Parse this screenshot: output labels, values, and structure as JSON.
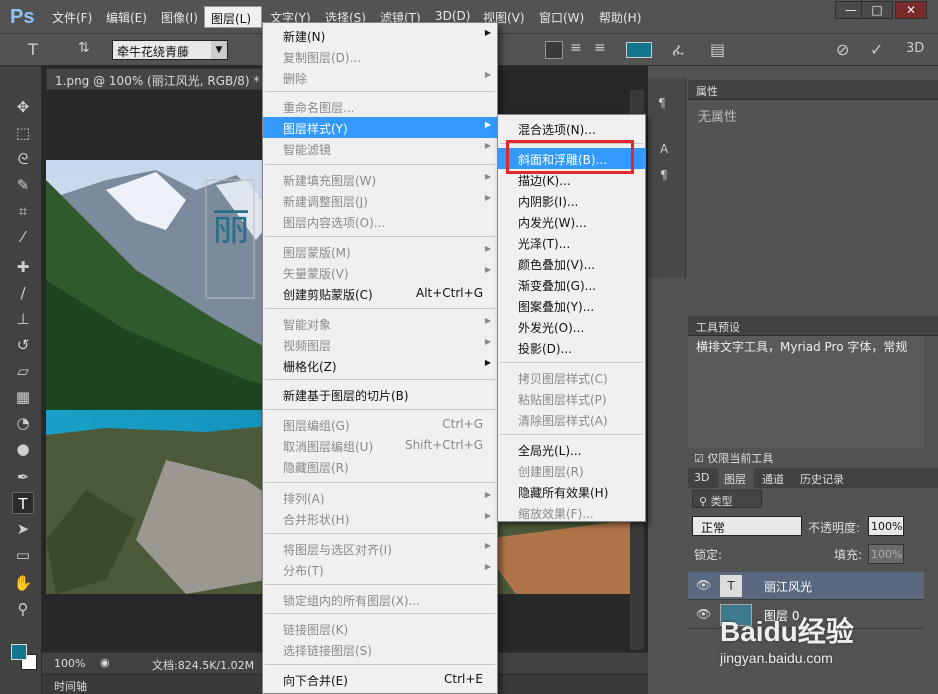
{
  "app": {
    "logo": "Ps"
  },
  "menubar": [
    "文件(F)",
    "编辑(E)",
    "图像(I)",
    "图层(L)",
    "文字(Y)",
    "选择(S)",
    "滤镜(T)",
    "3D(D)",
    "视图(V)",
    "窗口(W)",
    "帮助(H)"
  ],
  "window_controls": [
    "—",
    "□",
    "✕"
  ],
  "options": {
    "font_family": "牵牛花绕青藤",
    "t_label": "T"
  },
  "document": {
    "tab": "1.png @ 100% (丽江风光, RGB/8) *",
    "close": "×",
    "zoom": "100%",
    "doc_size": "文档:824.5K/1.02M",
    "timeline": "时间轴"
  },
  "layer_menu": [
    {
      "label": "新建(N)",
      "arrow": true
    },
    {
      "label": "复制图层(D)...",
      "disabled": true
    },
    {
      "label": "删除",
      "arrow": true,
      "disabled": true
    },
    {
      "label": "重命名图层...",
      "disabled": true
    },
    {
      "label": "图层样式(Y)",
      "arrow": true,
      "highlight": true
    },
    {
      "label": "智能滤镜",
      "arrow": true,
      "disabled": true
    },
    {
      "label": "新建填充图层(W)",
      "arrow": true,
      "disabled": true
    },
    {
      "label": "新建调整图层(J)",
      "arrow": true,
      "disabled": true
    },
    {
      "label": "图层内容选项(O)...",
      "disabled": true
    },
    {
      "label": "图层蒙版(M)",
      "arrow": true,
      "disabled": true
    },
    {
      "label": "矢量蒙版(V)",
      "arrow": true,
      "disabled": true
    },
    {
      "label": "创建剪贴蒙版(C)",
      "shortcut": "Alt+Ctrl+G"
    },
    {
      "label": "智能对象",
      "arrow": true,
      "disabled": true
    },
    {
      "label": "视频图层",
      "arrow": true,
      "disabled": true
    },
    {
      "label": "栅格化(Z)",
      "arrow": true
    },
    {
      "label": "新建基于图层的切片(B)"
    },
    {
      "label": "图层编组(G)",
      "shortcut": "Ctrl+G",
      "disabled": true
    },
    {
      "label": "取消图层编组(U)",
      "shortcut": "Shift+Ctrl+G",
      "disabled": true
    },
    {
      "label": "隐藏图层(R)",
      "disabled": true
    },
    {
      "label": "排列(A)",
      "arrow": true,
      "disabled": true
    },
    {
      "label": "合并形状(H)",
      "arrow": true,
      "disabled": true
    },
    {
      "label": "将图层与选区对齐(I)",
      "arrow": true,
      "disabled": true
    },
    {
      "label": "分布(T)",
      "arrow": true,
      "disabled": true
    },
    {
      "label": "锁定组内的所有图层(X)...",
      "disabled": true
    },
    {
      "label": "链接图层(K)",
      "disabled": true
    },
    {
      "label": "选择链接图层(S)",
      "disabled": true
    },
    {
      "label": "向下合并(E)",
      "shortcut": "Ctrl+E"
    }
  ],
  "style_menu": [
    {
      "label": "混合选项(N)..."
    },
    {
      "label": "斜面和浮雕(B)...",
      "highlight": true
    },
    {
      "label": "描边(K)..."
    },
    {
      "label": "内阴影(I)..."
    },
    {
      "label": "内发光(W)..."
    },
    {
      "label": "光泽(T)..."
    },
    {
      "label": "颜色叠加(V)..."
    },
    {
      "label": "渐变叠加(G)..."
    },
    {
      "label": "图案叠加(Y)..."
    },
    {
      "label": "外发光(O)..."
    },
    {
      "label": "投影(D)..."
    },
    {
      "label": "拷贝图层样式(C)",
      "disabled": true
    },
    {
      "label": "粘贴图层样式(P)",
      "disabled": true
    },
    {
      "label": "清除图层样式(A)",
      "disabled": true
    },
    {
      "label": "全局光(L)..."
    },
    {
      "label": "创建图层(R)",
      "disabled": true
    },
    {
      "label": "隐藏所有效果(H)"
    },
    {
      "label": "缩放效果(F)...",
      "disabled": true
    }
  ],
  "properties": {
    "title": "属性",
    "content": "无属性"
  },
  "tool_presets": {
    "title": "工具预设",
    "item": "横排文字工具，Myriad Pro 字体，常规",
    "current_only": "仅限当前工具"
  },
  "layers": {
    "tabs": [
      "3D",
      "图层",
      "通道",
      "历史记录"
    ],
    "filter": "类型",
    "blend": "正常",
    "opacity_label": "不透明度:",
    "opacity": "100%",
    "lock_label": "锁定:",
    "fill_label": "填充:",
    "fill": "100%",
    "items": [
      {
        "name": "丽江风光",
        "thumb": "T"
      },
      {
        "name": "图层 0"
      }
    ]
  },
  "watermark": {
    "brand": "Baidu经验",
    "url": "jingyan.baidu.com"
  },
  "colors": {
    "accent": "#3399ff",
    "highlight_box": "#e4262d",
    "foreground": "#11778f"
  }
}
